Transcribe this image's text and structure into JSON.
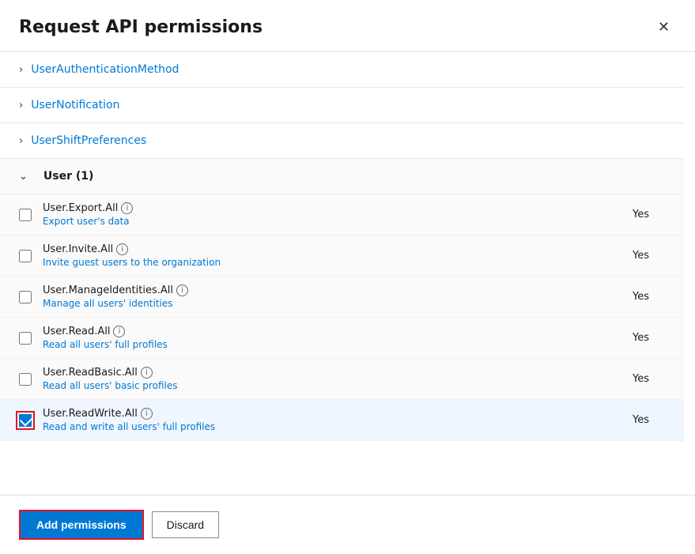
{
  "dialog": {
    "title": "Request API permissions",
    "close_label": "×"
  },
  "collapsed_sections": [
    {
      "id": "UserAuthenticationMethod",
      "label": "UserAuthenticationMethod"
    },
    {
      "id": "UserNotification",
      "label": "UserNotification"
    },
    {
      "id": "UserShiftPreferences",
      "label": "UserShiftPreferences"
    }
  ],
  "expanded_section": {
    "label": "User (1)"
  },
  "permissions": [
    {
      "id": "user_export_all",
      "name": "User.Export.All",
      "description": "Export user's data",
      "admin_consent": "Yes",
      "checked": false,
      "selected": false
    },
    {
      "id": "user_invite_all",
      "name": "User.Invite.All",
      "description": "Invite guest users to the organization",
      "admin_consent": "Yes",
      "checked": false,
      "selected": false
    },
    {
      "id": "user_manage_identities_all",
      "name": "User.ManageIdentities.All",
      "description": "Manage all users' identities",
      "admin_consent": "Yes",
      "checked": false,
      "selected": false
    },
    {
      "id": "user_read_all",
      "name": "User.Read.All",
      "description": "Read all users' full profiles",
      "admin_consent": "Yes",
      "checked": false,
      "selected": false
    },
    {
      "id": "user_read_basic_all",
      "name": "User.ReadBasic.All",
      "description": "Read all users' basic profiles",
      "admin_consent": "Yes",
      "checked": false,
      "selected": false
    },
    {
      "id": "user_readwrite_all",
      "name": "User.ReadWrite.All",
      "description": "Read and write all users' full profiles",
      "admin_consent": "Yes",
      "checked": true,
      "selected": true
    }
  ],
  "footer": {
    "add_label": "Add permissions",
    "discard_label": "Discard"
  },
  "icons": {
    "close": "✕",
    "chevron_right": "›",
    "chevron_down": "∨",
    "info": "i"
  }
}
